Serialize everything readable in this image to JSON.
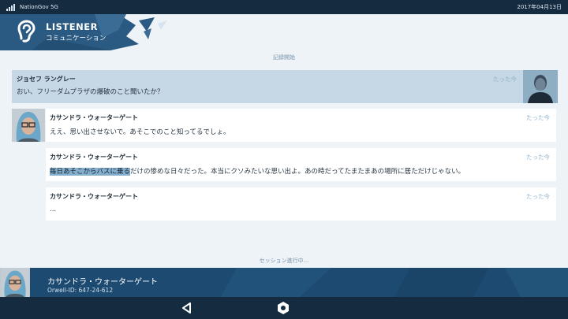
{
  "status_bar": {
    "carrier": "NationGov 5G",
    "date": "2017年04月13日"
  },
  "header": {
    "title": "LISTENER",
    "subtitle": "コミュニケーション"
  },
  "log": {
    "start_label": "記録開始",
    "messages": [
      {
        "sender": "ジョセフ ラングレー",
        "text": "おい、フリーダムプラザの爆破のこと聞いたか？",
        "time": "たった今"
      },
      {
        "sender": "カサンドラ・ウォーターゲート",
        "text": "ええ、思い出させないで。あそこでのこと知ってるでしょ。",
        "time": "たった今"
      },
      {
        "sender": "カサンドラ・ウォーターゲート",
        "text_highlight": "毎日あそこからバスに乗る",
        "text_rest": "だけの惨めな日々だった。本当にクソみたいな思い出よ。あの時だってたまたまあの場所に居ただけじゃない。",
        "time": "たった今"
      },
      {
        "sender": "カサンドラ・ウォーターゲート",
        "text": "...",
        "time": "たった今"
      }
    ],
    "session_label": "セッション進行中..."
  },
  "footer": {
    "name": "カサンドラ・ウォーターゲート",
    "id": "Orwell-ID: 647-24-612"
  },
  "colors": {
    "header_bg": "#2a5a82",
    "footer_bg": "#1c4a70",
    "status_bg": "#152b40",
    "highlight": "#86aecd"
  },
  "icons": {
    "header": "ear-icon",
    "back": "back-triangle-icon",
    "home": "home-hexagon-icon"
  }
}
